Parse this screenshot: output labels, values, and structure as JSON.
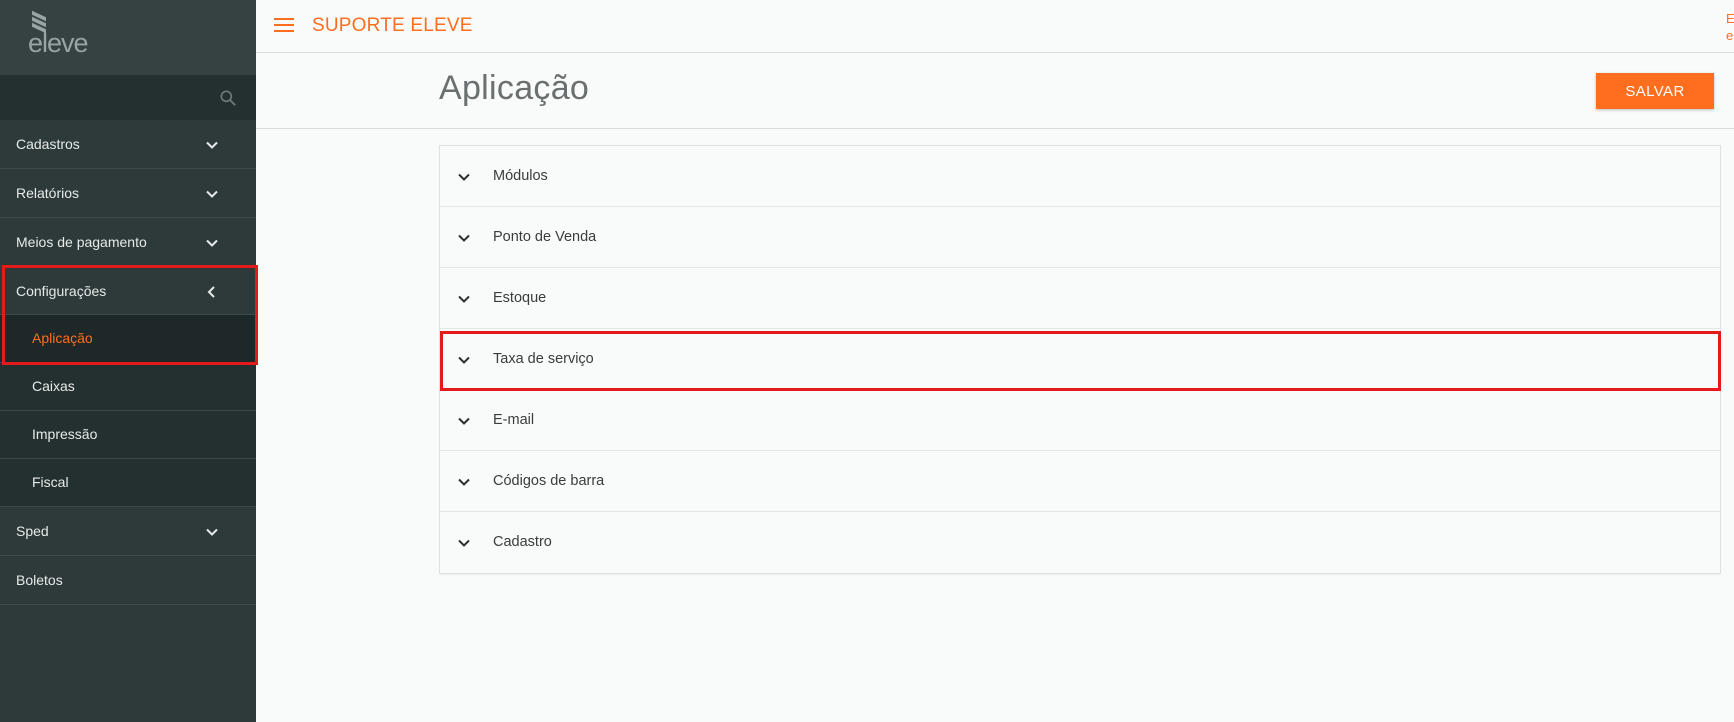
{
  "logo": {
    "text": "eleve"
  },
  "search": {
    "placeholder": "",
    "icon": "search-icon"
  },
  "sidebar": {
    "items": [
      {
        "label": "Cadastros",
        "icon": "chevron-down-icon"
      },
      {
        "label": "Relatórios",
        "icon": "chevron-down-icon"
      },
      {
        "label": "Meios de pagamento",
        "icon": "chevron-down-icon"
      },
      {
        "label": "Configurações",
        "icon": "chevron-left-icon",
        "expanded": true,
        "children": [
          {
            "label": "Aplicação",
            "active": true
          },
          {
            "label": "Caixas"
          },
          {
            "label": "Impressão"
          },
          {
            "label": "Fiscal"
          }
        ]
      },
      {
        "label": "Sped",
        "icon": "chevron-down-icon"
      },
      {
        "label": "Boletos"
      }
    ]
  },
  "topbar": {
    "title": "SUPORTE ELEVE",
    "edge_text": "E",
    "edge_text2": "e"
  },
  "page": {
    "title": "Aplicação",
    "save_label": "SALVAR"
  },
  "accordion": {
    "items": [
      {
        "label": "Módulos"
      },
      {
        "label": "Ponto de Venda"
      },
      {
        "label": "Estoque"
      },
      {
        "label": "Taxa de serviço",
        "highlighted": true
      },
      {
        "label": "E-mail"
      },
      {
        "label": "Códigos de barra"
      },
      {
        "label": "Cadastro"
      }
    ]
  },
  "colors": {
    "accent": "#ff6d1f",
    "sidebar_bg": "#2e3a3a",
    "highlight": "#e41b1b"
  }
}
